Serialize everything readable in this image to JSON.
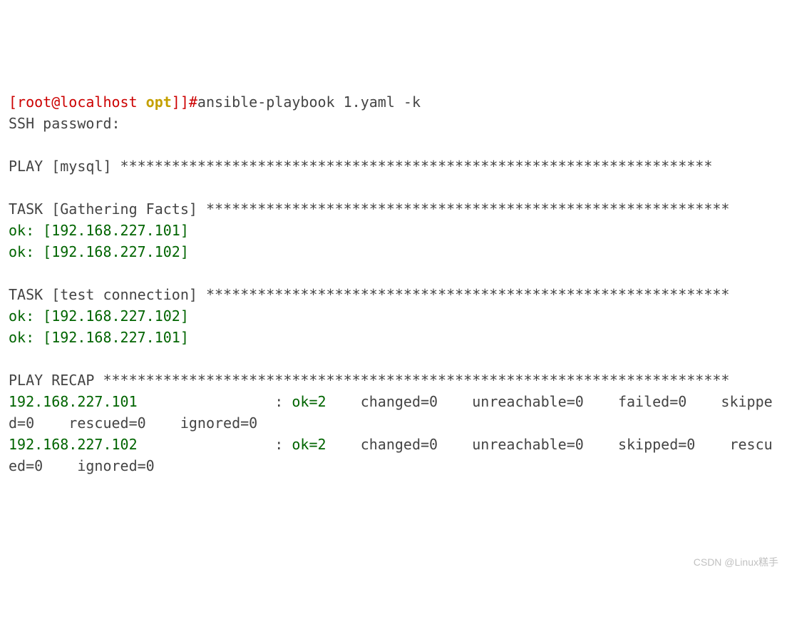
{
  "prompt": {
    "open_bracket": "[",
    "user_host": "root@localhost",
    "sep": " ",
    "cwd": "opt",
    "close": "]]#",
    "command": "ansible-playbook 1.yaml -k"
  },
  "ssh_password_label": "SSH password:",
  "play_header": {
    "prefix": "PLAY [",
    "name": "mysql",
    "suffix": "] *********************************************************************"
  },
  "task_gather": {
    "prefix": "TASK [",
    "name": "Gathering Facts",
    "suffix": "] *************************************************************"
  },
  "task_gather_results": {
    "ok1": "ok: [192.168.227.101]",
    "ok2": "ok: [192.168.227.102]"
  },
  "task_test": {
    "prefix": "TASK [",
    "name": "test connection",
    "suffix": "] *************************************************************"
  },
  "task_test_results": {
    "ok1": "ok: [192.168.227.102]",
    "ok2": "ok: [192.168.227.101]"
  },
  "recap_header": "PLAY RECAP *************************************************************************",
  "recap_hosts": [
    {
      "host": "192.168.227.101",
      "pad": "                : ",
      "ok": "ok=2",
      "rest": "    changed=0    unreachable=0    failed=0    skipped=0    rescued=0    ignored=0"
    },
    {
      "host": "192.168.227.102",
      "pad": "                : ",
      "ok": "ok=2",
      "rest": "    changed=0    unreachable=0    skipped=0    rescued=0    ignored=0"
    }
  ],
  "watermark": "CSDN @Linux糕手"
}
